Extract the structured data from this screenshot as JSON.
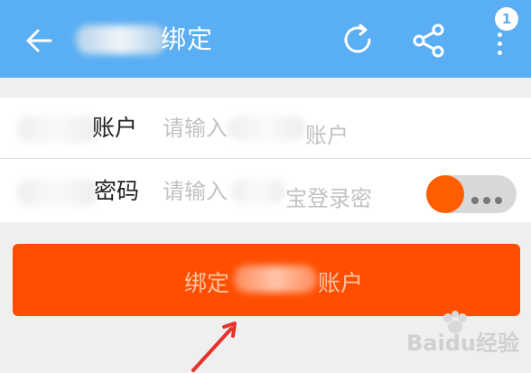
{
  "header": {
    "title": "绑定",
    "notification_count": "1",
    "background_color": "#5aaef3",
    "icons": [
      "back-arrow-icon",
      "refresh-icon",
      "share-icon",
      "more-vertical-icon"
    ]
  },
  "form": {
    "account_label": "账户",
    "account_placeholder": "请输入",
    "account_placeholder_suffix": "账户",
    "password_label": "密码",
    "password_placeholder": "请输入",
    "password_placeholder_suffix": "宝登录密",
    "password_visibility_toggle": "toggle-visibility-icon"
  },
  "bind_button": {
    "label_prefix": "绑定",
    "label_suffix": "账户",
    "color": "#ff4e00"
  },
  "watermark": {
    "text": "Baidu经验"
  }
}
